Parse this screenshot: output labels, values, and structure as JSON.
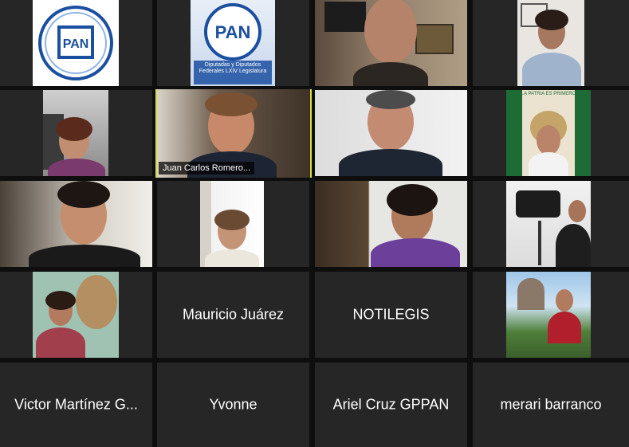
{
  "app": {
    "view": "gallery",
    "accent_color": "#d8e13a"
  },
  "participants": [
    {
      "id": "p1",
      "name": "",
      "display": "logo",
      "logo_text": "PAN"
    },
    {
      "id": "p2",
      "name": "",
      "display": "logo",
      "logo_text": "PAN",
      "logo_subtitle": "Diputadas y Diputados Federales LXIV Legislatura"
    },
    {
      "id": "p3",
      "name": "",
      "display": "video"
    },
    {
      "id": "p4",
      "name": "",
      "display": "video"
    },
    {
      "id": "p5",
      "name": "",
      "display": "video"
    },
    {
      "id": "p6",
      "name": "Juan Carlos Romero...",
      "display": "video",
      "active_speaker": true
    },
    {
      "id": "p7",
      "name": "",
      "display": "video"
    },
    {
      "id": "p8",
      "name": "",
      "display": "video",
      "banner_text": "LA PATRIA ES PRIMERO"
    },
    {
      "id": "p9",
      "name": "",
      "display": "video"
    },
    {
      "id": "p10",
      "name": "",
      "display": "video"
    },
    {
      "id": "p11",
      "name": "",
      "display": "video"
    },
    {
      "id": "p12",
      "name": "",
      "display": "video"
    },
    {
      "id": "p13",
      "name": "",
      "display": "video"
    },
    {
      "id": "p14",
      "name": "Mauricio Juárez",
      "display": "name"
    },
    {
      "id": "p15",
      "name": "NOTILEGIS",
      "display": "name"
    },
    {
      "id": "p16",
      "name": "",
      "display": "video"
    },
    {
      "id": "p17",
      "name": "Victor Martínez G...",
      "display": "name"
    },
    {
      "id": "p18",
      "name": "Yvonne",
      "display": "name"
    },
    {
      "id": "p19",
      "name": "Ariel Cruz GPPAN",
      "display": "name"
    },
    {
      "id": "p20",
      "name": "merari barranco",
      "display": "name"
    }
  ]
}
